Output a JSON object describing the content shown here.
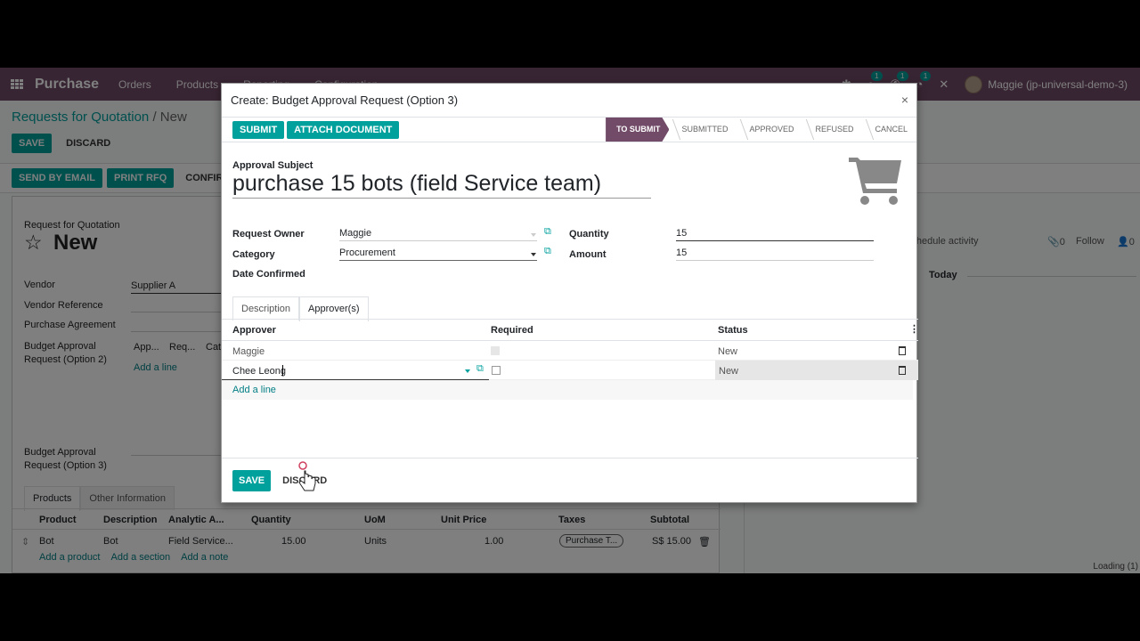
{
  "navbar": {
    "app_name": "Purchase",
    "menu": [
      "Orders",
      "Products",
      "Reporting",
      "Configuration"
    ],
    "systray": [
      {
        "icon": "bug-icon",
        "badge": ""
      },
      {
        "icon": "chat-icon",
        "badge": "1"
      },
      {
        "icon": "phone-icon",
        "badge": "1"
      },
      {
        "icon": "clock-icon",
        "badge": "1"
      },
      {
        "icon": "close-icon",
        "badge": ""
      }
    ],
    "user": "Maggie (jp-universal-demo-3)"
  },
  "background": {
    "breadcrumb": {
      "parent": "Requests for Quotation",
      "current": "New"
    },
    "save_label": "SAVE",
    "discard_label": "DISCARD",
    "status_buttons": [
      "SEND BY EMAIL",
      "PRINT RFQ",
      "CONFIRM ORDER"
    ],
    "form": {
      "doc_type": "Request for Quotation",
      "title": "New",
      "fields": [
        {
          "label": "Vendor",
          "value": "Supplier A"
        },
        {
          "label": "Vendor Reference",
          "value": ""
        },
        {
          "label": "Purchase Agreement",
          "value": ""
        },
        {
          "label": "Budget Approval Request (Option 2)",
          "value": ""
        },
        {
          "label": "Budget Approval Request (Option 3)",
          "value": ""
        }
      ],
      "option2_columns": [
        "App...",
        "Req...",
        "Cat..."
      ],
      "option2_add_line": "Add a line",
      "tabs": [
        "Products",
        "Other Information"
      ],
      "product_columns": [
        "Product",
        "Description",
        "Analytic A...",
        "Quantity",
        "UoM",
        "Unit Price",
        "Taxes",
        "Subtotal"
      ],
      "product_rows": [
        {
          "product": "Bot",
          "description": "Bot",
          "analytic": "Field Service...",
          "quantity": "15.00",
          "uom": "Units",
          "unit_price": "1.00",
          "taxes": "Purchase T...",
          "subtotal": "S$ 15.00"
        }
      ],
      "add_links": [
        "Add a product",
        "Add a section",
        "Add a note"
      ]
    },
    "chatter": {
      "schedule_activity": "Schedule activity",
      "attachments": "0",
      "follow": "Follow",
      "followers": "0",
      "today": "Today",
      "loading": "Loading (1)"
    }
  },
  "modal": {
    "title": "Create: Budget Approval Request (Option 3)",
    "buttons": {
      "submit": "SUBMIT",
      "attach": "ATTACH DOCUMENT"
    },
    "stages": [
      {
        "label": "TO SUBMIT",
        "active": true
      },
      {
        "label": "SUBMITTED",
        "active": false
      },
      {
        "label": "APPROVED",
        "active": false
      },
      {
        "label": "REFUSED",
        "active": false
      },
      {
        "label": "CANCEL",
        "active": false
      }
    ],
    "subject_label": "Approval Subject",
    "subject": "purchase 15 bots (field Service team)",
    "fields": {
      "request_owner": {
        "label": "Request Owner",
        "value": "Maggie"
      },
      "category": {
        "label": "Category",
        "value": "Procurement"
      },
      "date_confirmed": {
        "label": "Date Confirmed",
        "value": ""
      },
      "quantity": {
        "label": "Quantity",
        "value": "15"
      },
      "amount": {
        "label": "Amount",
        "value": "15"
      }
    },
    "tabs": [
      "Description",
      "Approver(s)"
    ],
    "active_tab": "Approver(s)",
    "approvers": {
      "columns": [
        "Approver",
        "Required",
        "Status"
      ],
      "rows": [
        {
          "approver": "Maggie",
          "required": false,
          "status": "New"
        },
        {
          "approver": "Chee Leong",
          "required": false,
          "status": "New"
        }
      ],
      "add_line": "Add a line"
    },
    "footer": {
      "save": "SAVE",
      "discard": "DISCARD"
    }
  },
  "colors": {
    "brand": "#714b67",
    "primary": "#00a09d"
  }
}
